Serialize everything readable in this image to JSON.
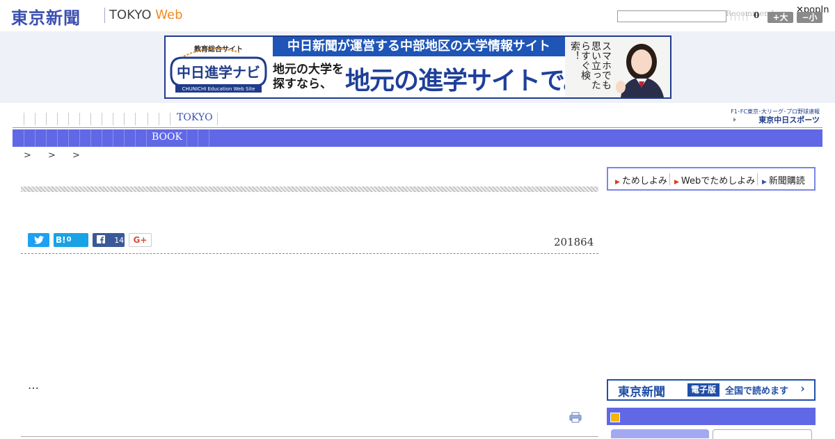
{
  "header": {
    "logo_jp": "東京新聞",
    "logo_en_main": "TOKYO",
    "logo_en_web": "Web",
    "search_placeholder": "",
    "recommend_label": "Recommend",
    "count": "0",
    "popin_label": "popIn",
    "size_large": "+大",
    "size_small": "−小"
  },
  "ad": {
    "logo_top": "教育総合サイト",
    "logo_main": "中日進学ナビ",
    "logo_sub": "CHUNICHI Education Web Site",
    "headline": "中日新聞が運営する中部地区の大学情報サイト",
    "left_copy_line1": "地元の大学を",
    "left_copy_line2": "探すなら、",
    "big_copy": "地元の進学サイトで。",
    "vertical_copy": "スマホでも思い立ったらすぐ検索！"
  },
  "nav": {
    "tokyo_label": "TOKYO",
    "sports_line1": "F1･FC東京･大リーグ･プロ野球速報",
    "sports_line2": "東京中日スポーツ",
    "book_label": "BOOK"
  },
  "breadcrumb": {
    "text": "> > >"
  },
  "share": {
    "hatena_label": "B!",
    "hatena_count": "0",
    "facebook_count": "14",
    "gplus_label": "G+"
  },
  "article": {
    "date": "201864",
    "ellipsis": "…"
  },
  "sidebar": {
    "sub_item_1": "ためしよみ",
    "sub_item_2": "Webでためしよみ",
    "sub_item_3": "新聞購読",
    "digital_logo": "東京新聞",
    "digital_badge": "電子版",
    "digital_text": "全国で読めます"
  },
  "colors": {
    "brand_blue": "#3b4fb0",
    "nav_bar": "#6068e6",
    "accent_orange": "#f08a1c"
  }
}
